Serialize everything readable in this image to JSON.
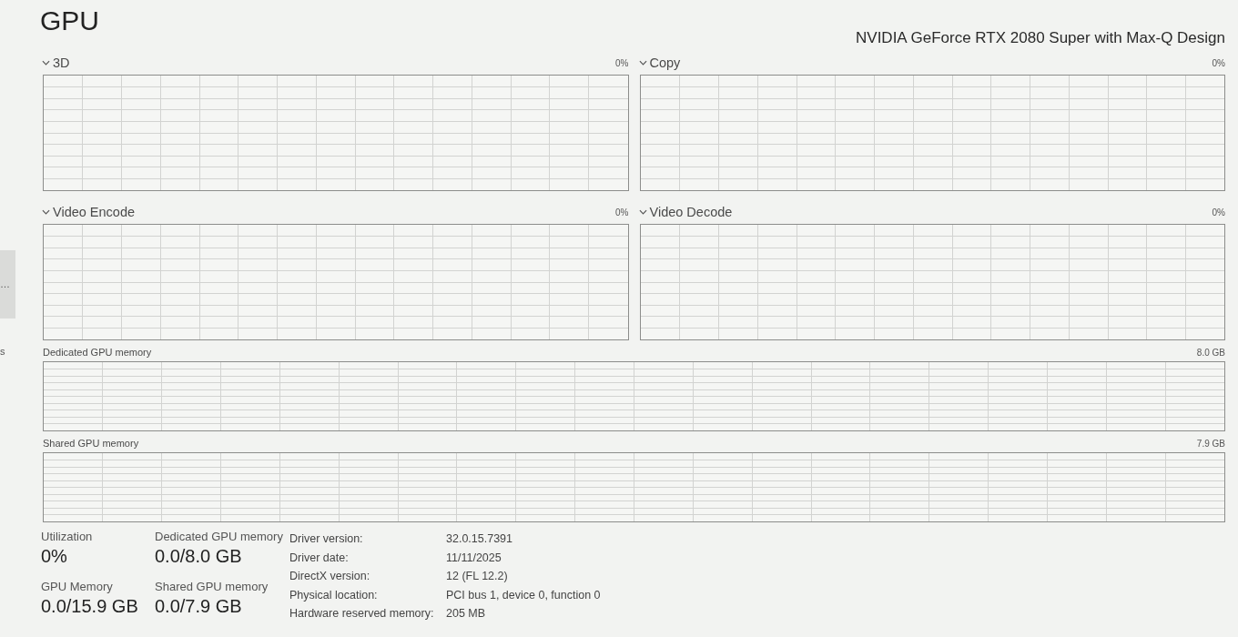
{
  "sidebar": {
    "items": [
      {
        "label": "…",
        "selected": true
      },
      {
        "label": "s",
        "selected": false
      }
    ]
  },
  "header": {
    "title": "GPU",
    "device_name": "NVIDIA GeForce RTX 2080 Super with Max-Q Design"
  },
  "engines": [
    {
      "label": "3D",
      "value": "0%",
      "expanded": true
    },
    {
      "label": "Copy",
      "value": "0%",
      "expanded": true
    },
    {
      "label": "Video Encode",
      "value": "0%",
      "expanded": true
    },
    {
      "label": "Video Decode",
      "value": "0%",
      "expanded": true
    }
  ],
  "memory_graphs": [
    {
      "label": "Dedicated GPU memory",
      "max": "8.0 GB"
    },
    {
      "label": "Shared GPU memory",
      "max": "7.9 GB"
    }
  ],
  "stats": [
    {
      "label": "Utilization",
      "value": "0%"
    },
    {
      "label": "Dedicated GPU memory",
      "value": "0.0/8.0 GB"
    },
    {
      "label": "GPU Memory",
      "value": "0.0/15.9 GB"
    },
    {
      "label": "Shared GPU memory",
      "value": "0.0/7.9 GB"
    }
  ],
  "properties": [
    {
      "label": "Driver version:",
      "value": "32.0.15.7391"
    },
    {
      "label": "Driver date:",
      "value": "11/11/2025"
    },
    {
      "label": "DirectX version:",
      "value": "12 (FL 12.2)"
    },
    {
      "label": "Physical location:",
      "value": "PCI bus 1, device 0, function 0"
    },
    {
      "label": "Hardware reserved memory:",
      "value": "205 MB"
    }
  ]
}
